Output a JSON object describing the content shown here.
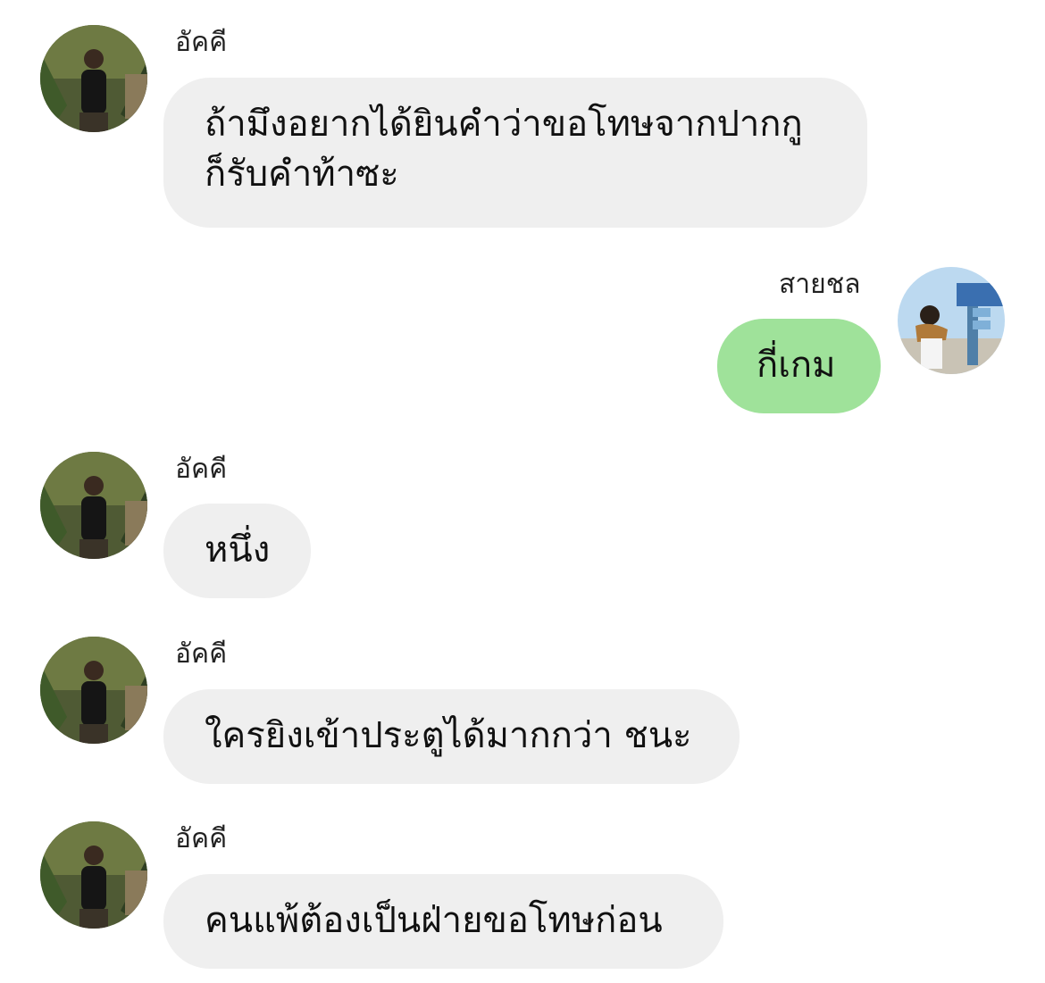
{
  "colors": {
    "incoming_bubble": "#efefef",
    "outgoing_bubble": "#9fe29a",
    "background": "#ffffff"
  },
  "messages": [
    {
      "sender": "อัคคี",
      "direction": "incoming",
      "lines": [
        "ถ้ามึงอยากได้ยินคำว่าขอโทษจากปากกู",
        "ก็รับคำท้าซะ"
      ]
    },
    {
      "sender": "สายชล",
      "direction": "outgoing",
      "lines": [
        "กี่เกม"
      ]
    },
    {
      "sender": "อัคคี",
      "direction": "incoming",
      "lines": [
        "หนึ่ง"
      ]
    },
    {
      "sender": "อัคคี",
      "direction": "incoming",
      "lines": [
        "ใครยิงเข้าประตูได้มากกว่า ชนะ"
      ]
    },
    {
      "sender": "อัคคี",
      "direction": "incoming",
      "lines": [
        "คนแพ้ต้องเป็นฝ่ายขอโทษก่อน"
      ]
    }
  ]
}
